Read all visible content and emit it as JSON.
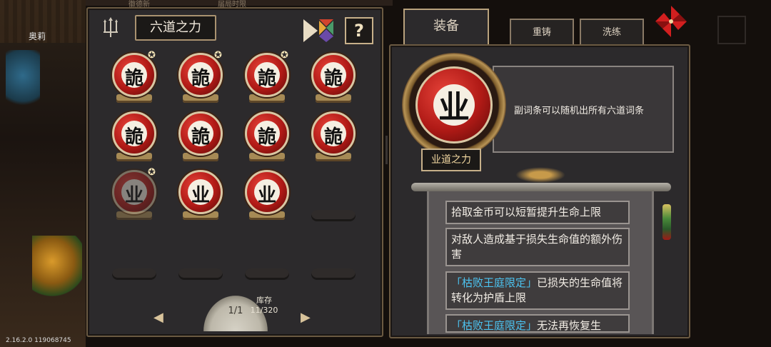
{
  "hud": {
    "npc_name": "奥莉",
    "version": "2.16.2.0 119068745",
    "top_text_left": "徽德新",
    "top_text_right": "届局时限"
  },
  "left_panel": {
    "title": "六道之力",
    "help_label": "?",
    "slots": [
      {
        "glyph": "詭",
        "star": true,
        "state": "filled"
      },
      {
        "glyph": "詭",
        "star": true,
        "state": "filled"
      },
      {
        "glyph": "詭",
        "star": true,
        "state": "filled"
      },
      {
        "glyph": "詭",
        "star": false,
        "state": "filled"
      },
      {
        "glyph": "詭",
        "star": false,
        "state": "filled"
      },
      {
        "glyph": "詭",
        "star": false,
        "state": "filled"
      },
      {
        "glyph": "詭",
        "star": false,
        "state": "filled"
      },
      {
        "glyph": "詭",
        "star": false,
        "state": "filled"
      },
      {
        "glyph": "业",
        "star": true,
        "state": "dim"
      },
      {
        "glyph": "业",
        "star": false,
        "state": "filled"
      },
      {
        "glyph": "业",
        "star": false,
        "state": "filled"
      },
      {
        "glyph": "",
        "star": false,
        "state": "empty"
      },
      {
        "glyph": "",
        "star": false,
        "state": "empty"
      },
      {
        "glyph": "",
        "star": false,
        "state": "empty"
      },
      {
        "glyph": "",
        "star": false,
        "state": "empty"
      },
      {
        "glyph": "",
        "star": false,
        "state": "empty"
      }
    ],
    "pager": {
      "page": "1/1",
      "arrow_left": "◀",
      "arrow_right": "▶"
    },
    "stock": {
      "label": "库存",
      "count": "11/320"
    }
  },
  "tabs": [
    {
      "label": "装备",
      "active": true
    },
    {
      "label": "重铸",
      "active": false
    },
    {
      "label": "洗练",
      "active": false
    }
  ],
  "detail": {
    "glyph": "业",
    "name": "业道之力",
    "description": "副词条可以随机出所有六道词条",
    "affixes": [
      {
        "tag": "",
        "text": "拾取金币可以短暂提升生命上限"
      },
      {
        "tag": "",
        "text": "对敌人造成基于损失生命值的额外伤害"
      },
      {
        "tag": "「枯败王庭限定」",
        "text": "已损失的生命值将转化为护盾上限"
      },
      {
        "tag": "「枯败王庭限定」",
        "text": "无法再恢复生"
      }
    ]
  },
  "colors": {
    "accent_gold": "#c7b08a",
    "orb_red": "#b01a16",
    "tag_blue": "#4cc3f0"
  },
  "icons": {
    "trident": "trident-icon",
    "tangram": "tangram-icon",
    "pinwheel": "pinwheel-icon"
  }
}
